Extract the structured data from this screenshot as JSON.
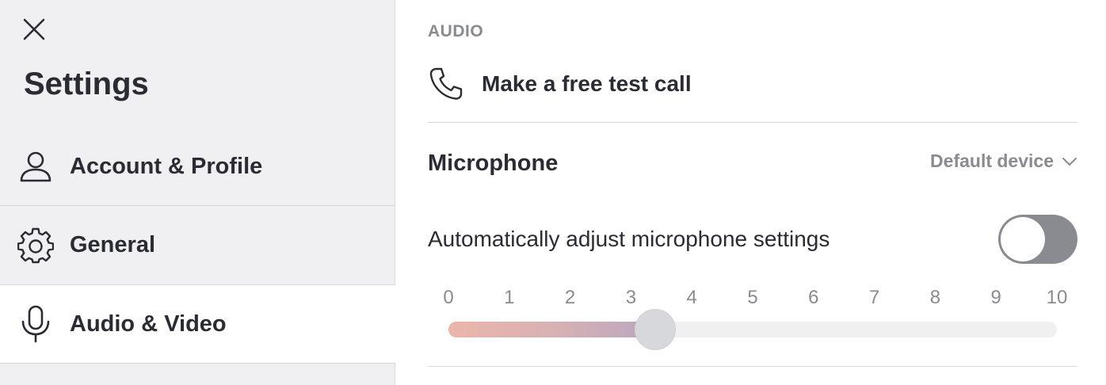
{
  "sidebar": {
    "close_icon": "close-icon",
    "title": "Settings",
    "items": [
      {
        "label": "Account & Profile",
        "icon": "person-icon",
        "active": false
      },
      {
        "label": "General",
        "icon": "gear-icon",
        "active": false
      },
      {
        "label": "Audio & Video",
        "icon": "microphone-icon",
        "active": true
      }
    ]
  },
  "main": {
    "section_label": "AUDIO",
    "test_call": {
      "label": "Make a free test call",
      "icon": "phone-icon"
    },
    "microphone": {
      "title": "Microphone",
      "device": "Default device",
      "auto_adjust_label": "Automatically adjust microphone settings",
      "auto_adjust_enabled": false,
      "level_ticks": [
        "0",
        "1",
        "2",
        "3",
        "4",
        "5",
        "6",
        "7",
        "8",
        "9",
        "10"
      ],
      "level_min": 0,
      "level_max": 10,
      "level_value": 3.4
    }
  },
  "colors": {
    "sidebar_bg": "#f0f0f2",
    "text_primary": "#2b2c33",
    "text_muted": "#8a8b91",
    "toggle_off": "#8a8b91",
    "slider_fill_start": "#ecb6ab",
    "slider_fill_end": "#b9a6bf"
  }
}
